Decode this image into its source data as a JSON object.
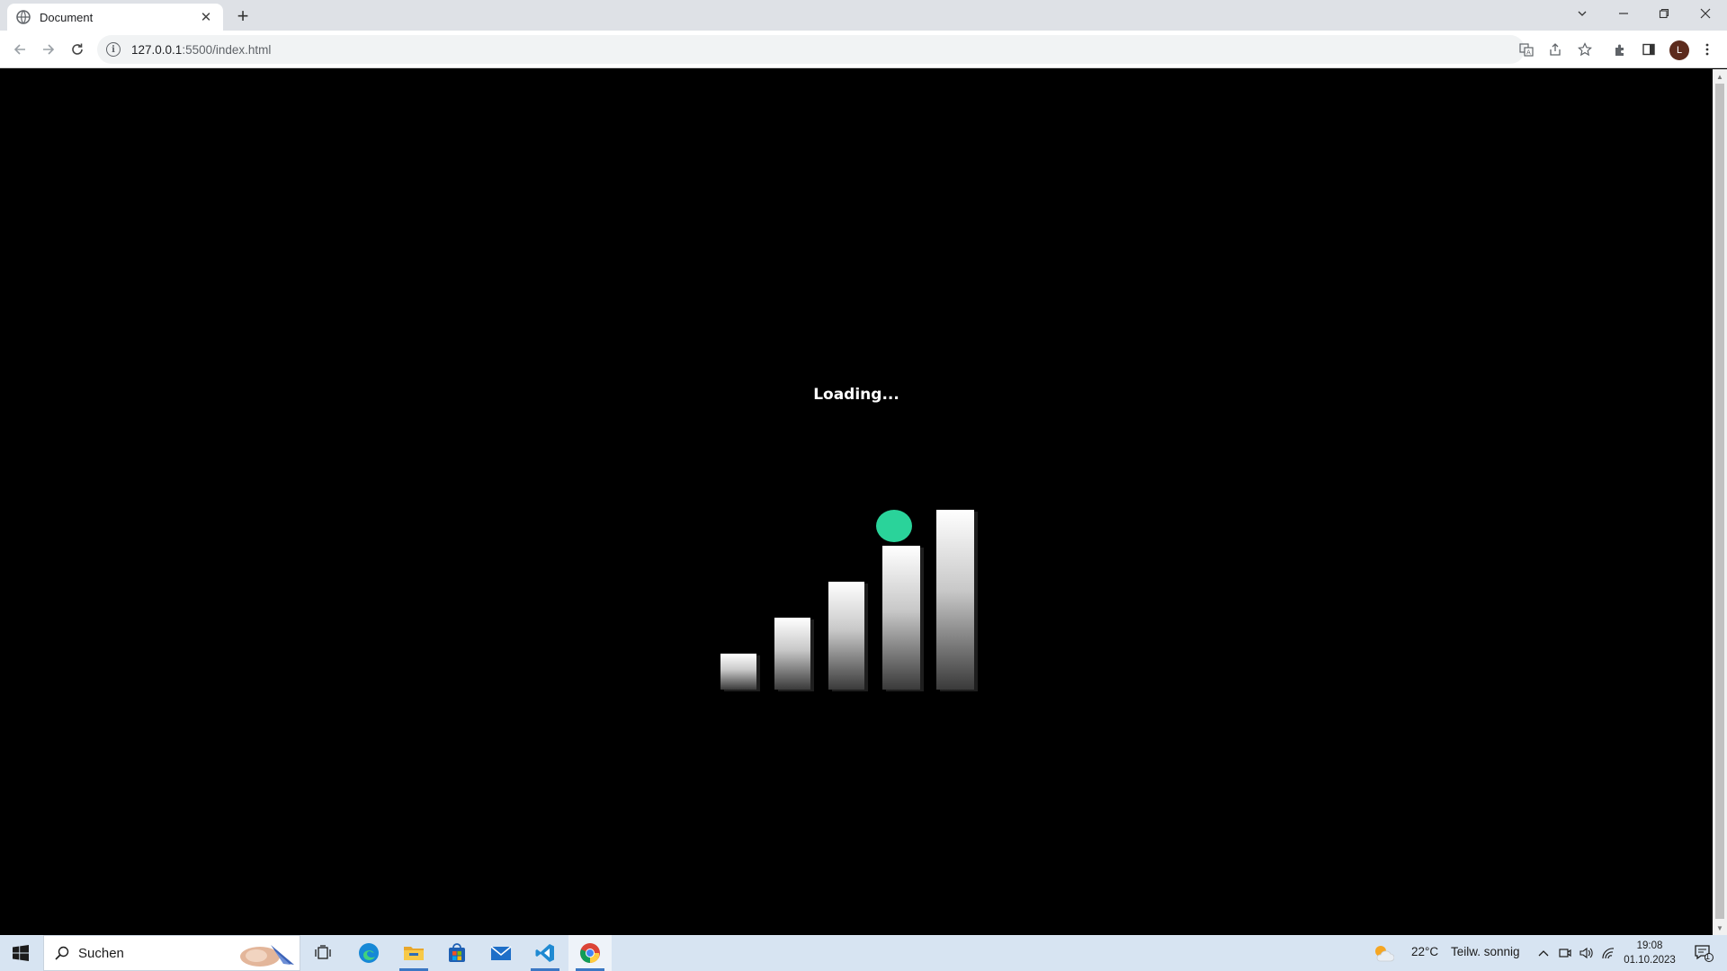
{
  "browser": {
    "tab_title": "Document",
    "new_tab": "+",
    "url_host": "127.0.0.1",
    "url_path": ":5500/index.html",
    "profile_initial": "L"
  },
  "page": {
    "loading_text": "Loading...",
    "bar_color_top": "#ffffff",
    "bar_color_bottom": "#3a3a3a",
    "ball_color": "#2ad39a",
    "bar_levels": [
      1,
      2,
      3,
      4,
      5
    ]
  },
  "taskbar": {
    "search_label": "Suchen",
    "weather_temp": "22°C",
    "weather_text": "Teilw. sonnig",
    "time": "19:08",
    "date": "01.10.2023",
    "notification_count": "1"
  }
}
